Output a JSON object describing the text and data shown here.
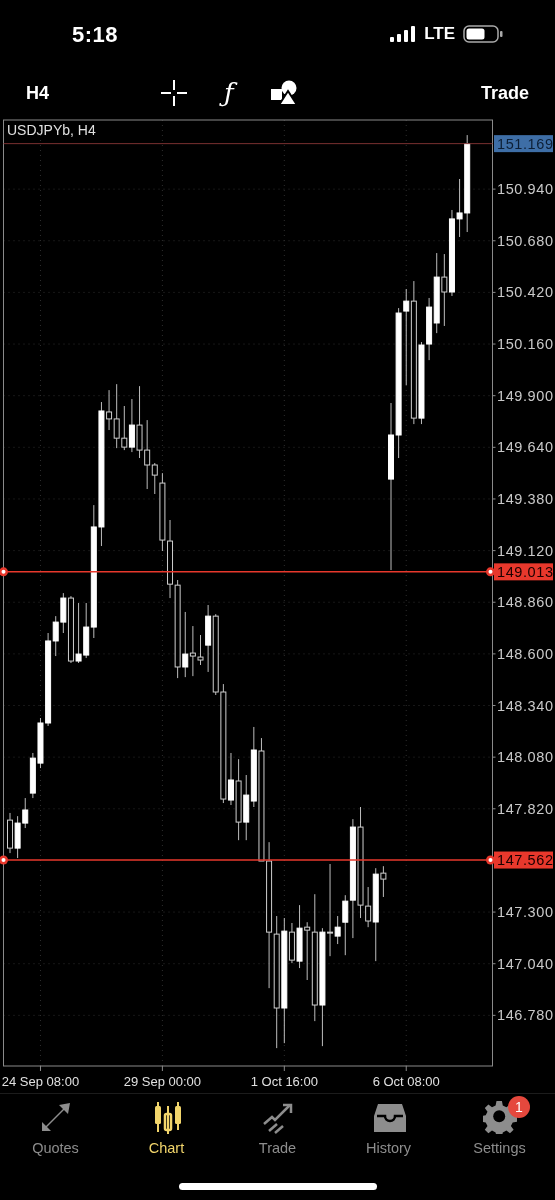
{
  "status_bar": {
    "time": "5:18",
    "network": "LTE"
  },
  "toolbar": {
    "timeframe": "H4",
    "function_glyph": "ƒ",
    "trade": "Trade"
  },
  "chart": {
    "symbol_label": "USDJPYb, H4",
    "chart_data": {
      "type": "candlestick",
      "grid": true,
      "ylim": [
        146.525,
        151.288
      ],
      "categories": [
        null,
        null,
        null,
        null,
        "24 Sep 08:00",
        null,
        null,
        null,
        null,
        null,
        null,
        null,
        null,
        null,
        null,
        null,
        null,
        null,
        null,
        null,
        "29 Sep 00:00",
        null,
        null,
        null,
        null,
        null,
        null,
        null,
        null,
        null,
        null,
        null,
        null,
        null,
        null,
        null,
        "1 Oct 16:00",
        null,
        null,
        null,
        null,
        null,
        null,
        null,
        null,
        null,
        null,
        null,
        null,
        null,
        null,
        null,
        "6 Oct 08:00",
        null,
        null,
        null,
        null,
        null,
        null,
        null,
        null
      ],
      "ohlc": [
        [
          147.763,
          147.799,
          147.597,
          147.622
        ],
        [
          147.622,
          147.783,
          147.572,
          147.748
        ],
        [
          147.748,
          147.874,
          147.723,
          147.814
        ],
        [
          147.899,
          148.101,
          147.874,
          148.075
        ],
        [
          148.05,
          148.277,
          148.025,
          148.252
        ],
        [
          148.252,
          148.705,
          148.237,
          148.665
        ],
        [
          148.665,
          148.79,
          148.589,
          148.76
        ],
        [
          148.76,
          148.906,
          148.705,
          148.881
        ],
        [
          148.881,
          148.891,
          148.554,
          148.564
        ],
        [
          148.564,
          148.856,
          148.554,
          148.599
        ],
        [
          148.594,
          148.856,
          148.579,
          148.735
        ],
        [
          148.735,
          149.349,
          148.68,
          149.239
        ],
        [
          149.239,
          149.868,
          149.143,
          149.823
        ],
        [
          149.818,
          149.928,
          149.727,
          149.783
        ],
        [
          149.783,
          149.958,
          149.636,
          149.686
        ],
        [
          149.686,
          149.848,
          149.626,
          149.641
        ],
        [
          149.641,
          149.883,
          149.616,
          149.752
        ],
        [
          149.752,
          149.948,
          149.586,
          149.626
        ],
        [
          149.626,
          149.777,
          149.43,
          149.551
        ],
        [
          149.551,
          149.561,
          149.405,
          149.5
        ],
        [
          149.46,
          149.51,
          149.118,
          149.173
        ],
        [
          149.168,
          149.274,
          148.881,
          148.951
        ],
        [
          148.946,
          148.972,
          148.478,
          148.534
        ],
        [
          148.534,
          148.811,
          148.483,
          148.599
        ],
        [
          148.604,
          148.74,
          148.488,
          148.589
        ],
        [
          148.584,
          148.695,
          148.544,
          148.569
        ],
        [
          148.644,
          148.846,
          148.509,
          148.79
        ],
        [
          148.79,
          148.8,
          148.393,
          148.408
        ],
        [
          148.408,
          148.448,
          147.849,
          147.869
        ],
        [
          147.864,
          148.101,
          147.839,
          147.965
        ],
        [
          147.96,
          148.07,
          147.662,
          147.753
        ],
        [
          147.753,
          147.99,
          147.662,
          147.889
        ],
        [
          147.859,
          148.232,
          147.829,
          148.116
        ],
        [
          148.111,
          148.176,
          147.557,
          147.557
        ],
        [
          147.557,
          147.652,
          146.917,
          147.199
        ],
        [
          147.189,
          147.28,
          146.615,
          146.817
        ],
        [
          146.817,
          147.27,
          146.64,
          147.204
        ],
        [
          147.199,
          147.245,
          147.043,
          147.058
        ],
        [
          147.053,
          147.335,
          147.018,
          147.219
        ],
        [
          147.224,
          147.249,
          146.958,
          147.209
        ],
        [
          147.199,
          147.39,
          146.751,
          146.832
        ],
        [
          146.832,
          147.219,
          146.625,
          147.199
        ],
        [
          147.199,
          147.542,
          147.078,
          147.199
        ],
        [
          147.179,
          147.28,
          147.139,
          147.224
        ],
        [
          147.249,
          147.385,
          147.083,
          147.355
        ],
        [
          147.36,
          147.768,
          147.169,
          147.728
        ],
        [
          147.728,
          147.829,
          147.27,
          147.335
        ],
        [
          147.33,
          147.426,
          147.224,
          147.255
        ],
        [
          147.25,
          147.521,
          147.053,
          147.491
        ],
        [
          147.496,
          147.531,
          147.376,
          147.466
        ],
        [
          149.48,
          149.863,
          149.022,
          149.702
        ],
        [
          149.702,
          150.341,
          149.586,
          150.316
        ],
        [
          150.326,
          150.437,
          149.953,
          150.376
        ],
        [
          150.376,
          150.477,
          149.757,
          149.787
        ],
        [
          149.787,
          150.17,
          149.757,
          150.155
        ],
        [
          150.16,
          150.392,
          150.079,
          150.346
        ],
        [
          150.266,
          150.618,
          150.215,
          150.497
        ],
        [
          150.497,
          150.613,
          150.251,
          150.422
        ],
        [
          150.422,
          150.835,
          150.402,
          150.79
        ],
        [
          150.79,
          150.991,
          150.699,
          150.82
        ],
        [
          150.82,
          151.212,
          150.724,
          151.169
        ]
      ],
      "yticks": [
        {
          "value": 150.94,
          "label": "150.940"
        },
        {
          "value": 150.68,
          "label": "150.680"
        },
        {
          "value": 150.42,
          "label": "150.420"
        },
        {
          "value": 150.16,
          "label": "150.160"
        },
        {
          "value": 149.9,
          "label": "149.900"
        },
        {
          "value": 149.64,
          "label": "149.640"
        },
        {
          "value": 149.38,
          "label": "149.380"
        },
        {
          "value": 149.12,
          "label": "149.120"
        },
        {
          "value": 148.86,
          "label": "148.860"
        },
        {
          "value": 148.6,
          "label": "148.600"
        },
        {
          "value": 148.34,
          "label": "148.340"
        },
        {
          "value": 148.08,
          "label": "148.080"
        },
        {
          "value": 147.82,
          "label": "147.820"
        },
        {
          "value": 147.3,
          "label": "147.300"
        },
        {
          "value": 147.04,
          "label": "147.040"
        },
        {
          "value": 146.78,
          "label": "146.780"
        }
      ],
      "ref_lines": [
        {
          "axis": "y",
          "value": 151.169,
          "label": "151.169",
          "color": "#7a3030"
        },
        {
          "axis": "y",
          "value": 149.013,
          "label": "149.013",
          "color": "#e8382c"
        },
        {
          "axis": "y",
          "value": 147.562,
          "label": "147.562",
          "color": "#e8382c"
        }
      ]
    }
  },
  "tabs": [
    {
      "kind": "quotes",
      "label": "Quotes",
      "selected": false
    },
    {
      "kind": "chart",
      "label": "Chart",
      "selected": true
    },
    {
      "kind": "trade",
      "label": "Trade",
      "selected": false
    },
    {
      "kind": "history",
      "label": "History",
      "selected": false
    },
    {
      "kind": "settings",
      "label": "Settings",
      "selected": false,
      "badge": "1"
    }
  ]
}
